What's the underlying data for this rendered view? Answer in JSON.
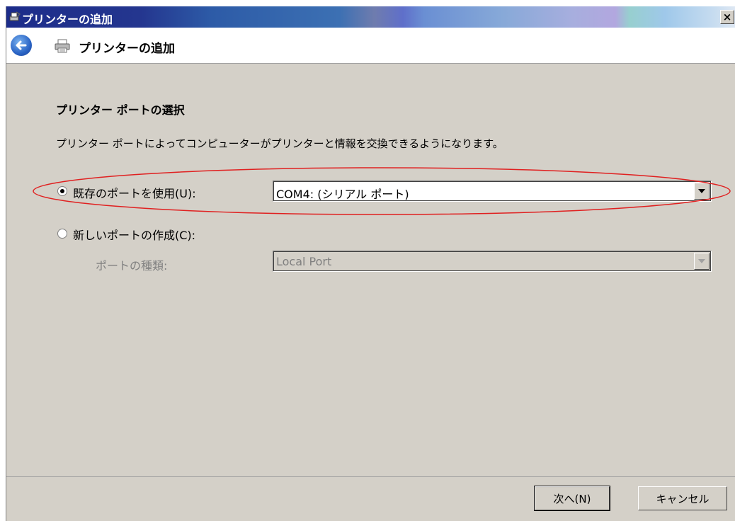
{
  "window": {
    "title": "プリンターの追加",
    "close_label": "×"
  },
  "nav": {
    "title": "プリンターの追加"
  },
  "main": {
    "heading": "プリンター ポートの選択",
    "description": "プリンター ポートによってコンピューターがプリンターと情報を交換できるようになります。",
    "options": [
      {
        "label": "既存のポートを使用(U):",
        "selected": true
      },
      {
        "label": "新しいポートの作成(C):",
        "selected": false
      }
    ],
    "existing_port_value": "COM4: (シリアル ポート)",
    "port_type_label": "ポートの種類:",
    "port_type_value": "Local Port"
  },
  "footer": {
    "next_label": "次へ(N)",
    "cancel_label": "キャンセル"
  },
  "colors": {
    "annotation": "#e02020",
    "dialog_bg": "#d4d0c8"
  },
  "icons": [
    "printer-icon",
    "back-arrow-icon",
    "dropdown-arrow-icon",
    "close-icon"
  ]
}
